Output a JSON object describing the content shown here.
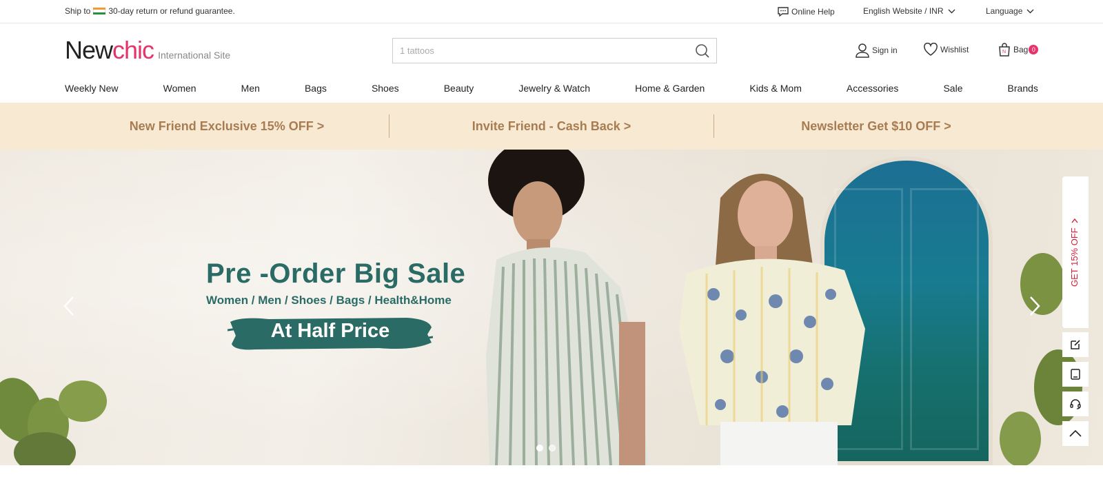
{
  "topbar": {
    "ship_label": "Ship to",
    "guarantee": "30-day return or refund guarantee.",
    "online_help": "Online Help",
    "website_currency": "English Website / INR",
    "language": "Language"
  },
  "header": {
    "logo_new": "New",
    "logo_chic": "chic",
    "site_label": "International Site",
    "search_placeholder": "1 tattoos",
    "sign_in": "Sign in",
    "wishlist": "Wishlist",
    "bag": "Bag",
    "bag_count": "0"
  },
  "nav": {
    "items": [
      "Weekly New",
      "Women",
      "Men",
      "Bags",
      "Shoes",
      "Beauty",
      "Jewelry & Watch",
      "Home & Garden",
      "Kids & Mom",
      "Accessories",
      "Sale",
      "Brands"
    ]
  },
  "promo": {
    "items": [
      "New Friend Exclusive 15% OFF >",
      "Invite Friend - Cash Back >",
      "Newsletter Get $10 OFF >"
    ]
  },
  "hero": {
    "title": "Pre -Order Big Sale",
    "subtitle": "Women / Men / Shoes / Bags / Health&Home",
    "badge": "At Half Price",
    "slide_count": 2,
    "active_slide": 1
  },
  "side": {
    "promo_text": "GET 15% OFF",
    "icons": [
      "edit-icon",
      "tablet-icon",
      "headset-icon",
      "back-to-top-icon"
    ]
  },
  "colors": {
    "brand_pink": "#e5346b",
    "promo_bg": "#f8ead2",
    "promo_text": "#a87c52",
    "hero_green": "#2b6b66"
  }
}
